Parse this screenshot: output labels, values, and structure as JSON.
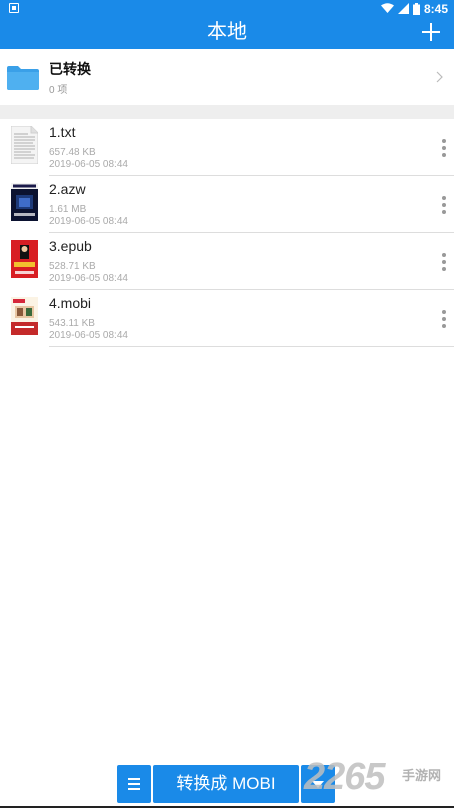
{
  "status_bar": {
    "time": "8:45"
  },
  "app_bar": {
    "title": "本地"
  },
  "folder": {
    "title": "已转换",
    "count": "0 项"
  },
  "files": [
    {
      "name": "1.txt",
      "size": "657.48 KB",
      "date": "2019-06-05 08:44",
      "thumb": "txt"
    },
    {
      "name": "2.azw",
      "size": "1.61 MB",
      "date": "2019-06-05 08:44",
      "thumb": "azw"
    },
    {
      "name": "3.epub",
      "size": "528.71 KB",
      "date": "2019-06-05 08:44",
      "thumb": "epub"
    },
    {
      "name": "4.mobi",
      "size": "543.11 KB",
      "date": "2019-06-05 08:44",
      "thumb": "mobi"
    }
  ],
  "bottom_bar": {
    "convert_label": "转换成 MOBI"
  },
  "watermark": {
    "number": "2265",
    "sub": "手游网"
  },
  "colors": {
    "primary": "#1a8ae8",
    "folder": "#3aa0e8"
  }
}
